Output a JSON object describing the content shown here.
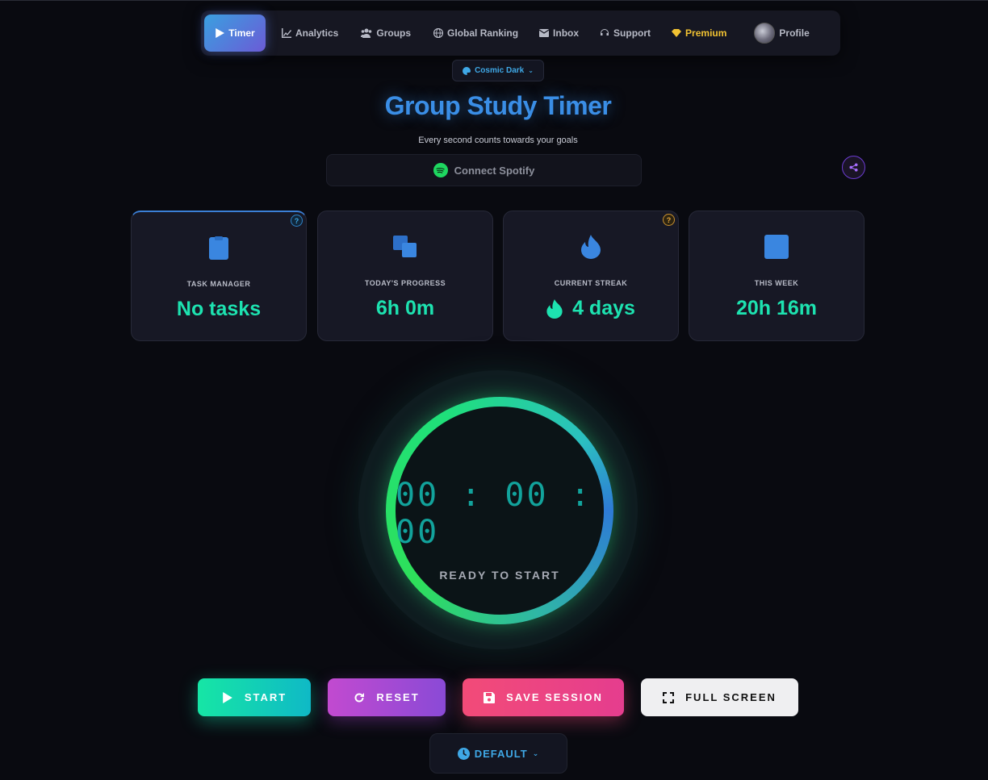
{
  "nav": {
    "items": [
      {
        "label": "Timer",
        "icon": "play-icon"
      },
      {
        "label": "Analytics",
        "icon": "chart-line-icon"
      },
      {
        "label": "Groups",
        "icon": "users-icon"
      },
      {
        "label": "Global Ranking",
        "icon": "globe-icon"
      },
      {
        "label": "Inbox",
        "icon": "envelope-icon"
      },
      {
        "label": "Support",
        "icon": "headset-icon"
      },
      {
        "label": "Premium",
        "icon": "gem-icon"
      },
      {
        "label": "Profile",
        "icon": "avatar"
      }
    ],
    "active": "Timer"
  },
  "theme": {
    "label": "Cosmic Dark",
    "icon": "palette-icon"
  },
  "header": {
    "title": "Group Study Timer",
    "subtitle": "Every second counts towards your goals"
  },
  "spotify": {
    "label": "Connect Spotify",
    "icon": "spotify-icon"
  },
  "stats": [
    {
      "label": "TASK MANAGER",
      "value": "No tasks",
      "icon": "clipboard-icon",
      "help": "?"
    },
    {
      "label": "TODAY'S PROGRESS",
      "value": "6h 0m",
      "icon": "copy-icon"
    },
    {
      "label": "CURRENT STREAK",
      "value": "4 days",
      "icon": "fire-icon",
      "help": "?"
    },
    {
      "label": "THIS WEEK",
      "value": "20h 16m",
      "icon": "square-icon"
    }
  ],
  "timer": {
    "time": "00:00:00",
    "status": "READY TO START"
  },
  "actions": {
    "start": "START",
    "reset": "RESET",
    "save": "SAVE SESSION",
    "fullscreen": "FULL SCREEN"
  },
  "mode": {
    "label": "DEFAULT",
    "icon": "clock-icon"
  },
  "colors": {
    "accent_blue": "#3a8ee6",
    "value_green": "#1de2b0",
    "start": "#16e6a5",
    "reset": "#c24ad0",
    "save": "#f24b78",
    "premium": "#f1c232"
  }
}
